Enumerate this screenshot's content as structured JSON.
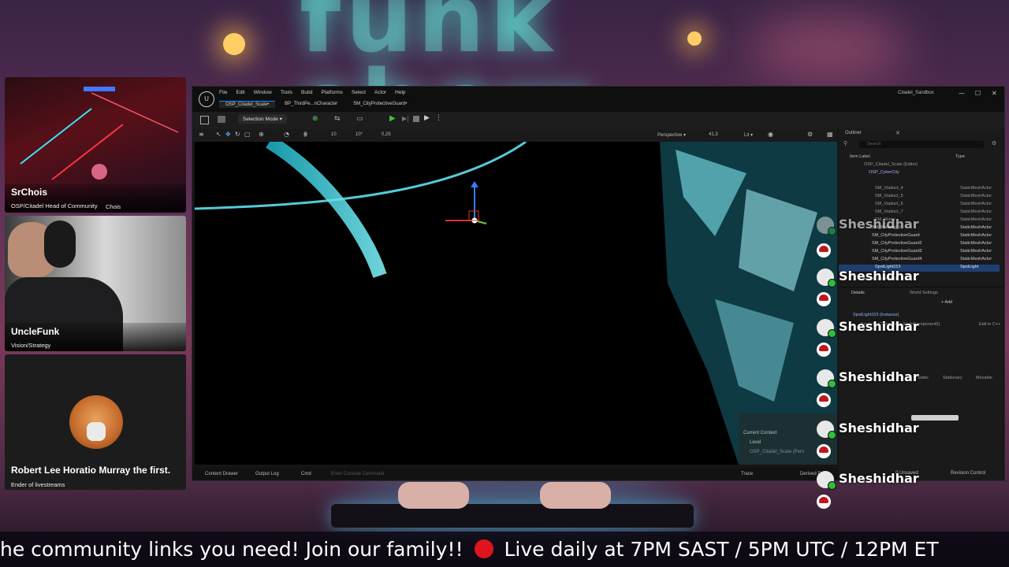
{
  "stream": {
    "hosts": [
      {
        "name": "SrChois",
        "role": "OSP/Citadel Head of Community",
        "watermark": "Chois"
      },
      {
        "name": "UncleFunk",
        "role": "Vision/Strategy"
      },
      {
        "name": "Robert Lee Horatio Murray the first.",
        "role": "Ender of livestreams"
      }
    ],
    "ticker": {
      "before": "he community links you need! Join our family!!",
      "after": "Live daily at 7PM SAST / 5PM UTC / 12PM ET"
    }
  },
  "editor": {
    "window_title": "Citadel_Sandbox",
    "logo": "U",
    "menu": [
      "File",
      "Edit",
      "Window",
      "Tools",
      "Build",
      "Platforms",
      "Select",
      "Actor",
      "Help"
    ],
    "tabs": [
      "OSP_Citadel_Scale•",
      "BP_ThirdPe...nCharacter",
      "SM_CityProtectiveGuard•"
    ],
    "toolbar": {
      "mode": "Selection Mode"
    },
    "viewport": {
      "perspective": "Perspective",
      "lit": "Lit",
      "fov": "41,3",
      "snap_grid": "10",
      "snap_rot": "10°",
      "snap_scale": "0,25"
    },
    "outliner": {
      "title": "Outliner",
      "search_placeholder": "Search",
      "col_label": "Item Label",
      "col_type": "Type",
      "rows": [
        {
          "label": "OSP_Citadel_Scale (Editor)",
          "type": ""
        },
        {
          "label": "OSP_CyberCity",
          "type": ""
        },
        {
          "label": "SM_Viaduct_4",
          "type": "StaticMeshActor"
        },
        {
          "label": "SM_Viaduct_5",
          "type": "StaticMeshActor"
        },
        {
          "label": "SM_Viaduct_6",
          "type": "StaticMeshActor"
        },
        {
          "label": "SM_Viaduct_7",
          "type": "StaticMeshActor"
        },
        {
          "label": "SM_Water",
          "type": "StaticMeshActor"
        },
        {
          "label": "SM_Building_1",
          "type": "StaticMeshActor"
        },
        {
          "label": "SM_CityProtectiveGuard",
          "type": "StaticMeshActor"
        },
        {
          "label": "SM_CityProtectiveGuard2",
          "type": "StaticMeshActor"
        },
        {
          "label": "SM_CityProtectiveGuard3",
          "type": "StaticMeshActor"
        },
        {
          "label": "SM_CityProtectiveGuard4",
          "type": "StaticMeshActor"
        },
        {
          "label": "SpotLight153",
          "type": "SpotLight"
        }
      ],
      "footer": "actors (1 selected)"
    },
    "details": {
      "tab": "Details",
      "world_settings": "World Settings",
      "selected": "SpotLight153 (Instance)",
      "component": "SpotLightComponent (LightComponent0)",
      "add": "+ Add",
      "edit_cpp": "Edit in C++",
      "mobility": [
        "Static",
        "Stationary",
        "Movable"
      ]
    },
    "context": {
      "label": "Current Context",
      "level": "Level",
      "level_name": "OSP_Citadel_Scale (Pers"
    },
    "statusbar": [
      "Content Drawer",
      "Output Log",
      "Cmd",
      "Enter Console Command",
      "Trace",
      "Derived Data",
      "0 Unsaved",
      "Revision Control"
    ]
  },
  "chat": {
    "messages": [
      {
        "user": "Sheshidhar"
      },
      {
        "user": "Sheshidhar"
      },
      {
        "user": "Sheshidhar"
      },
      {
        "user": "Sheshidhar"
      },
      {
        "user": "Sheshidhar"
      },
      {
        "user": "Sheshidhar"
      }
    ]
  },
  "colors": {
    "accent": "#0a84ff",
    "live": "#e0141c",
    "neon": "#4ff2e6"
  }
}
